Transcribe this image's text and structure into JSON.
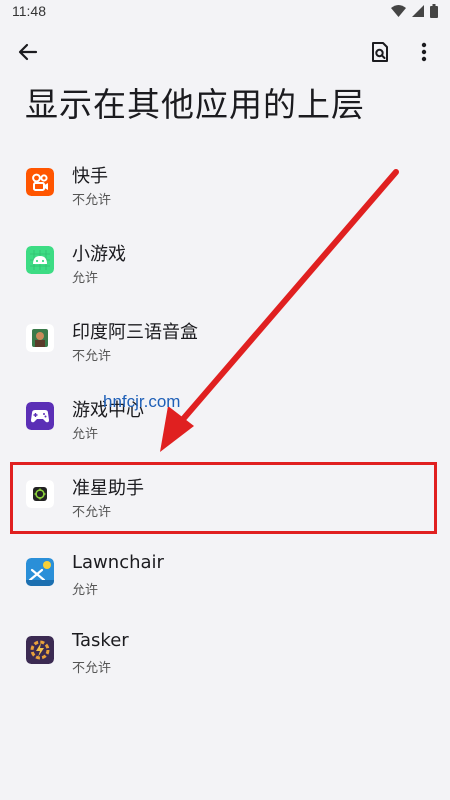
{
  "status_bar": {
    "time": "11:48"
  },
  "header": {
    "title": "显示在其他应用的上层"
  },
  "apps": [
    {
      "name": "快手",
      "status": "不允许",
      "icon": "kuaishou-icon"
    },
    {
      "name": "小游戏",
      "status": "允许",
      "icon": "android-icon"
    },
    {
      "name": "印度阿三语音盒",
      "status": "不允许",
      "icon": "voice-box-icon"
    },
    {
      "name": "游戏中心",
      "status": "允许",
      "icon": "gamepad-icon"
    },
    {
      "name": "准星助手",
      "status": "不允许",
      "icon": "crosshair-assistant-icon"
    },
    {
      "name": "Lawnchair",
      "status": "允许",
      "icon": "lawnchair-icon"
    },
    {
      "name": "Tasker",
      "status": "不允许",
      "icon": "tasker-icon"
    }
  ],
  "watermark": "hnfcjr.com",
  "colors": {
    "annotation": "#e02020",
    "watermark": "#1e5fb7"
  }
}
